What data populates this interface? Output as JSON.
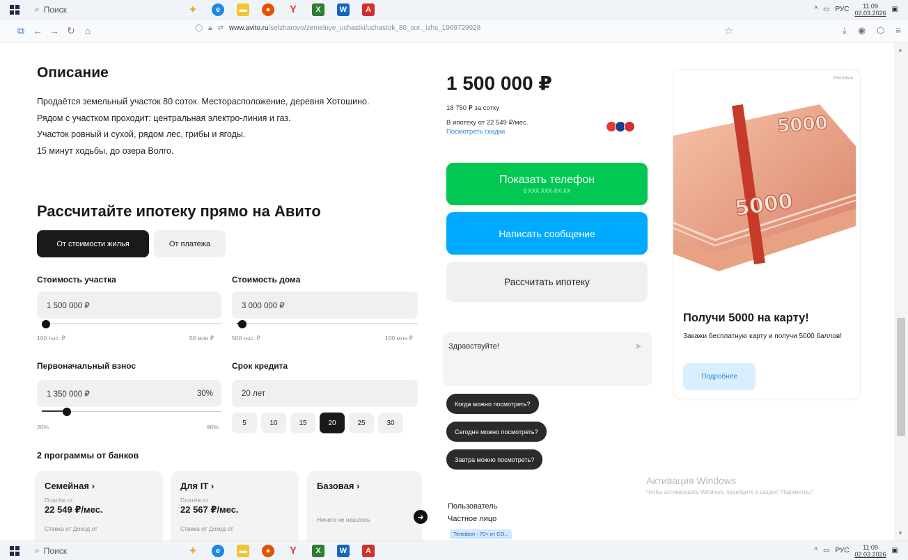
{
  "taskbar": {
    "search_label": "Поиск",
    "lang": "РУС",
    "time": "11:09",
    "date": "02.03.2026"
  },
  "browser": {
    "url_domain": "www.avito.ru",
    "url_path": "/selzharovo/zemelnye_uchastki/uchastok_80_sot._izhs_1969729928"
  },
  "description": {
    "title": "Описание",
    "lines": [
      "Продаётся земельный участок 80 соток. Месторасположение, деревня Хотошино.",
      "Рядом с участком проходит: центральная электро-линия и газ.",
      "Участок ровный и сухой, рядом лес, грибы и ягоды.",
      "15 минут ходьбы, до озера Волго."
    ]
  },
  "mortgage": {
    "title": "Рассчитайте ипотеку прямо на Авито",
    "toggle_active": "От стоимости жилья",
    "toggle_inactive": "От платежа",
    "plot_label": "Стоимость участка",
    "plot_value": "1 500 000 ₽",
    "plot_min": "100 тыс. ₽",
    "plot_max": "50 млн ₽",
    "house_label": "Стоимость дома",
    "house_value": "3 000 000 ₽",
    "house_min": "500 тыс. ₽",
    "house_max": "100 млн ₽",
    "down_label": "Первоначальный взнос",
    "down_value": "1 350 000 ₽",
    "down_pct": "30%",
    "down_min": "20%",
    "down_max": "90%",
    "term_label": "Срок кредита",
    "term_value": "20 лет",
    "term_options": [
      "5",
      "10",
      "15",
      "20",
      "25",
      "30"
    ],
    "term_selected": "20",
    "sliders": {
      "plot_level": 0.02,
      "house_level": 0.03,
      "down_level": 0.14
    },
    "programs_title": "2 программы от банков",
    "programs": [
      {
        "name": "Семейная ›",
        "label": "Платёж от",
        "value": "22 549 ₽/мес.",
        "foot": "Ставка от      Доход от"
      },
      {
        "name": "Для IT ›",
        "label": "Платёж от",
        "value": "22 567 ₽/мес.",
        "foot": "Ставка от      Доход от"
      },
      {
        "name": "Базовая ›",
        "label": "",
        "value": "",
        "foot": "Ничего не нашлось"
      }
    ]
  },
  "listing": {
    "price": "1 500 000 ₽",
    "per_unit": "18 750 ₽ за сотку",
    "mortgage_from": "В ипотеку от 22 549 ₽/мес.",
    "discount_link": "Посмотреть скидки",
    "phone_button": "Показать телефон",
    "phone_mask": "8 XXX XXX-XX-XX",
    "message_button": "Написать сообщение",
    "calc_button": "Рассчитать ипотеку",
    "chat_text": "Здравствуйте!",
    "quick_questions": [
      "Когда можно посмотреть?",
      "Сегодня можно посмотреть?",
      "Завтра можно посмотреть?"
    ],
    "seller_name": "Пользователь",
    "seller_type": "Частное лицо",
    "seller_badge": "Телефон · 70+ от СО..."
  },
  "ad": {
    "tag": "Реклама",
    "heading": "Получи 5000 на карту!",
    "text": "Закажи бесплатную карту и получи 5000 баллов!",
    "button": "Подробнее"
  },
  "watermark": {
    "title": "Активация Windows",
    "text": "Чтобы активировать Windows, перейдите в раздел \"Параметры\"."
  },
  "colors": {
    "green": "#00c853",
    "blue": "#00aaff",
    "link": "#2a8ae0"
  }
}
